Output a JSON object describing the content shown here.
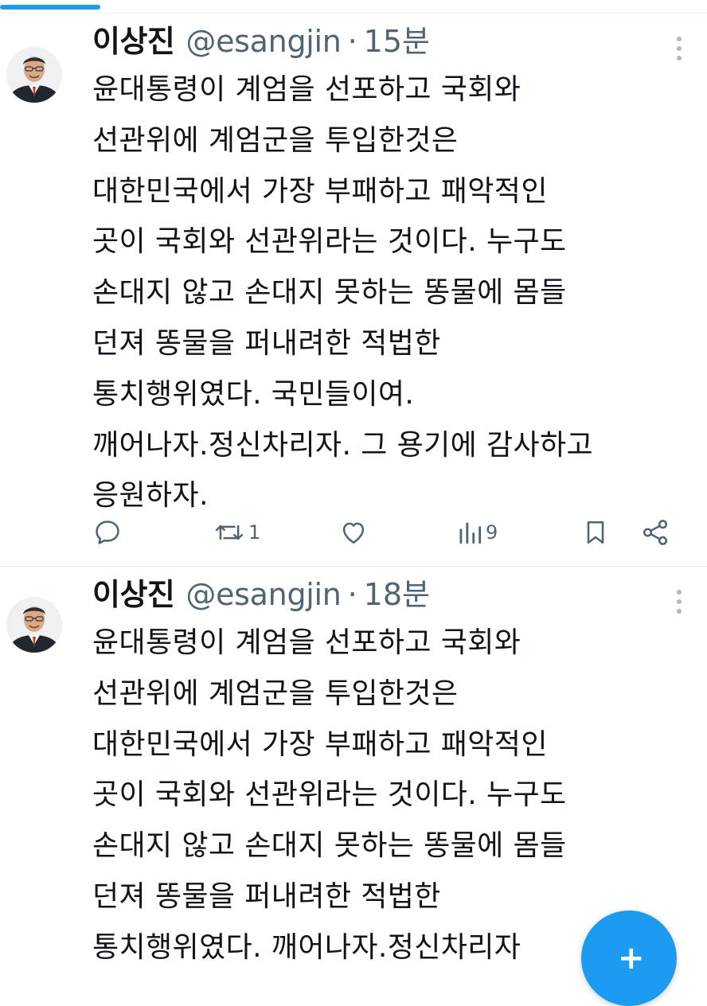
{
  "tweets": [
    {
      "author": {
        "name": "이상진",
        "handle": "@esangjin"
      },
      "separator": "·",
      "time": "15분",
      "body_lines": [
        "윤대통령이 계엄을 선포하고 국회와",
        "선관위에 계엄군을 투입한것은",
        "대한민국에서 가장 부패하고 패악적인",
        "곳이 국회와 선관위라는 것이다. 누구도",
        "손대지 않고 손대지 못하는 똥물에 몸들",
        "던져 똥물을 퍼내려한 적법한",
        "통치행위였다. 국민들이여.",
        "깨어나자.정신차리자. 그 용기에 감사하고",
        "응원하자."
      ],
      "actions": {
        "reply": {
          "icon": "reply-icon",
          "count": ""
        },
        "retweet": {
          "icon": "retweet-icon",
          "count": "1"
        },
        "like": {
          "icon": "heart-icon",
          "count": ""
        },
        "views": {
          "icon": "views-icon",
          "count": "9"
        },
        "bookmark": {
          "icon": "bookmark-icon"
        },
        "share": {
          "icon": "share-icon"
        }
      }
    },
    {
      "author": {
        "name": "이상진",
        "handle": "@esangjin"
      },
      "separator": "·",
      "time": "18분",
      "body_lines": [
        "윤대통령이 계엄을 선포하고 국회와",
        "선관위에 계엄군을 투입한것은",
        "대한민국에서 가장 부패하고 패악적인",
        "곳이 국회와 선관위라는 것이다. 누구도",
        "손대지 않고 손대지 못하는 똥물에 몸들",
        "던져 똥물을 퍼내려한 적법한",
        "통치행위였다. 깨어나자.정신차리자"
      ]
    }
  ],
  "colors": {
    "accent": "#1d9bf0",
    "text_primary": "#0f1419",
    "text_secondary": "#536471",
    "divider": "#e7eaec"
  },
  "fab": {
    "icon": "compose-plus-icon",
    "label": "+"
  }
}
